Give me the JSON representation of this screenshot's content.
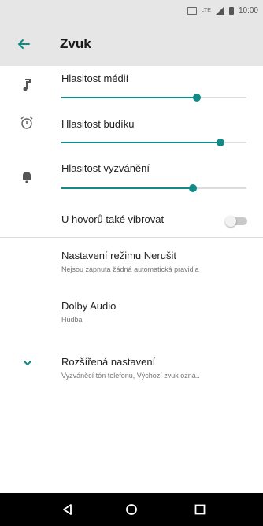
{
  "status_bar": {
    "time": "10:00",
    "network": "LTE"
  },
  "toolbar": {
    "title": "Zvuk"
  },
  "volumes": [
    {
      "label": "Hlasitost médií",
      "icon": "music-note-icon",
      "level": 0.73
    },
    {
      "label": "Hlasitost budíku",
      "icon": "alarm-clock-icon",
      "level": 0.86
    },
    {
      "label": "Hlasitost vyzvánění",
      "icon": "bell-icon",
      "level": 0.71
    }
  ],
  "vibrate": {
    "label": "U hovorů také vibrovat",
    "enabled": false
  },
  "preferences": [
    {
      "title": "Nastavení režimu Nerušit",
      "summary": "Nejsou zapnuta žádná automatická pravidla"
    },
    {
      "title": "Dolby Audio",
      "summary": "Hudba"
    },
    {
      "title": "Rozšířená nastavení",
      "summary": "Vyzváněcí tón telefonu, Výchozí zvuk ozná..",
      "icon": "chevron-down-icon"
    }
  ],
  "navbar": {
    "buttons": [
      "back-icon",
      "home-icon",
      "recents-icon"
    ]
  },
  "colors": {
    "accent": "#128a87",
    "toolbar_bg": "#e6e6e6"
  }
}
